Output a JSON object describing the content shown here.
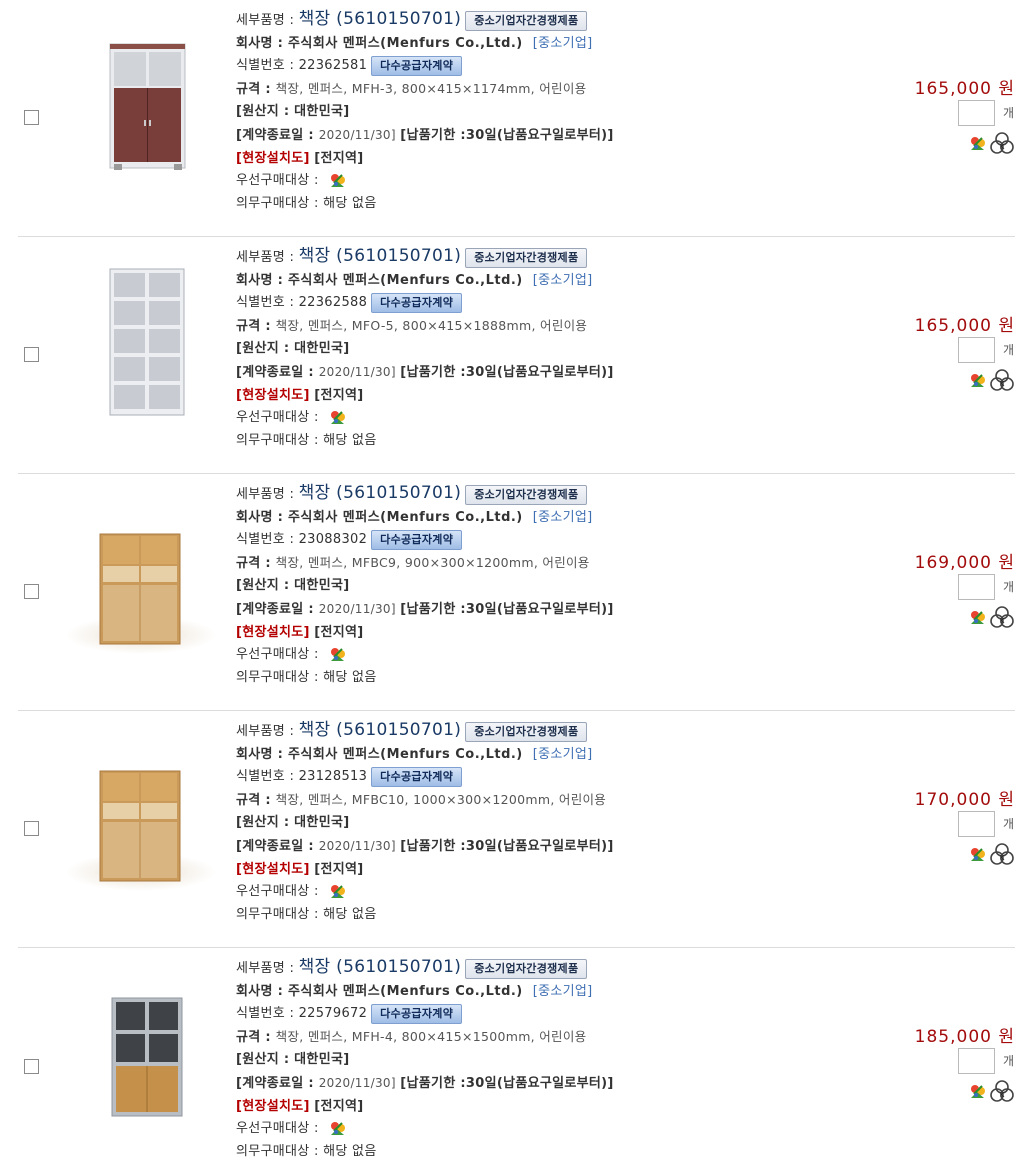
{
  "labels": {
    "detail_name": "세부품명 : ",
    "company": "회사명 : ",
    "id": "식별번호 : ",
    "spec": "규격 : ",
    "origin": "[원산지 : 대한민국]",
    "contract_end_prefix": "[계약종료일 : ",
    "delivery": "[납품기한 :30일(납품요구일로부터)]",
    "install": "[현장설치도]",
    "install_area": "[전지역]",
    "priority": "우선구매대상 : ",
    "mandatory": "의무구매대상 : 해당 없음",
    "unit": "개"
  },
  "colors": {
    "price": "#a30c0c",
    "title": "#1a3a66",
    "sme": "#3f6fb3",
    "install": "#b40000"
  },
  "products": [
    {
      "name": "책장 (5610150701)",
      "badge_comp": "중소기업자간경쟁제품",
      "company": "주식회사 멘퍼스(Menfurs Co.,Ltd.)",
      "sme": "[중소기업]",
      "id": "22362581",
      "badge_multi": "다수공급자계약",
      "spec": "책장, 멘퍼스, MFH-3, 800×415×1174mm, 어린이용",
      "contract_end": "2020/11/30]",
      "price": "165,000 원",
      "image": "bookshelf-dark-wood-doors-icon"
    },
    {
      "name": "책장 (5610150701)",
      "badge_comp": "중소기업자간경쟁제품",
      "company": "주식회사 멘퍼스(Menfurs Co.,Ltd.)",
      "sme": "[중소기업]",
      "id": "22362588",
      "badge_multi": "다수공급자계약",
      "spec": "책장, 멘퍼스, MFO-5, 800×415×1888mm, 어린이용",
      "contract_end": "2020/11/30]",
      "price": "165,000 원",
      "image": "bookshelf-gray-open-icon"
    },
    {
      "name": "책장 (5610150701)",
      "badge_comp": "중소기업자간경쟁제품",
      "company": "주식회사 멘퍼스(Menfurs Co.,Ltd.)",
      "sme": "[중소기업]",
      "id": "23088302",
      "badge_multi": "다수공급자계약",
      "spec": "책장, 멘퍼스, MFBC9, 900×300×1200mm, 어린이용",
      "contract_end": "2020/11/30]",
      "price": "169,000 원",
      "image": "bookshelf-oak-icon"
    },
    {
      "name": "책장 (5610150701)",
      "badge_comp": "중소기업자간경쟁제품",
      "company": "주식회사 멘퍼스(Menfurs Co.,Ltd.)",
      "sme": "[중소기업]",
      "id": "23128513",
      "badge_multi": "다수공급자계약",
      "spec": "책장, 멘퍼스, MFBC10, 1000×300×1200mm, 어린이용",
      "contract_end": "2020/11/30]",
      "price": "170,000 원",
      "image": "bookshelf-oak-icon"
    },
    {
      "name": "책장 (5610150701)",
      "badge_comp": "중소기업자간경쟁제품",
      "company": "주식회사 멘퍼스(Menfurs Co.,Ltd.)",
      "sme": "[중소기업]",
      "id": "22579672",
      "badge_multi": "다수공급자계약",
      "spec": "책장, 멘퍼스, MFH-4, 800×415×1500mm, 어린이용",
      "contract_end": "2020/11/30]",
      "price": "185,000 원",
      "image": "bookshelf-gray-oak-icon"
    }
  ]
}
